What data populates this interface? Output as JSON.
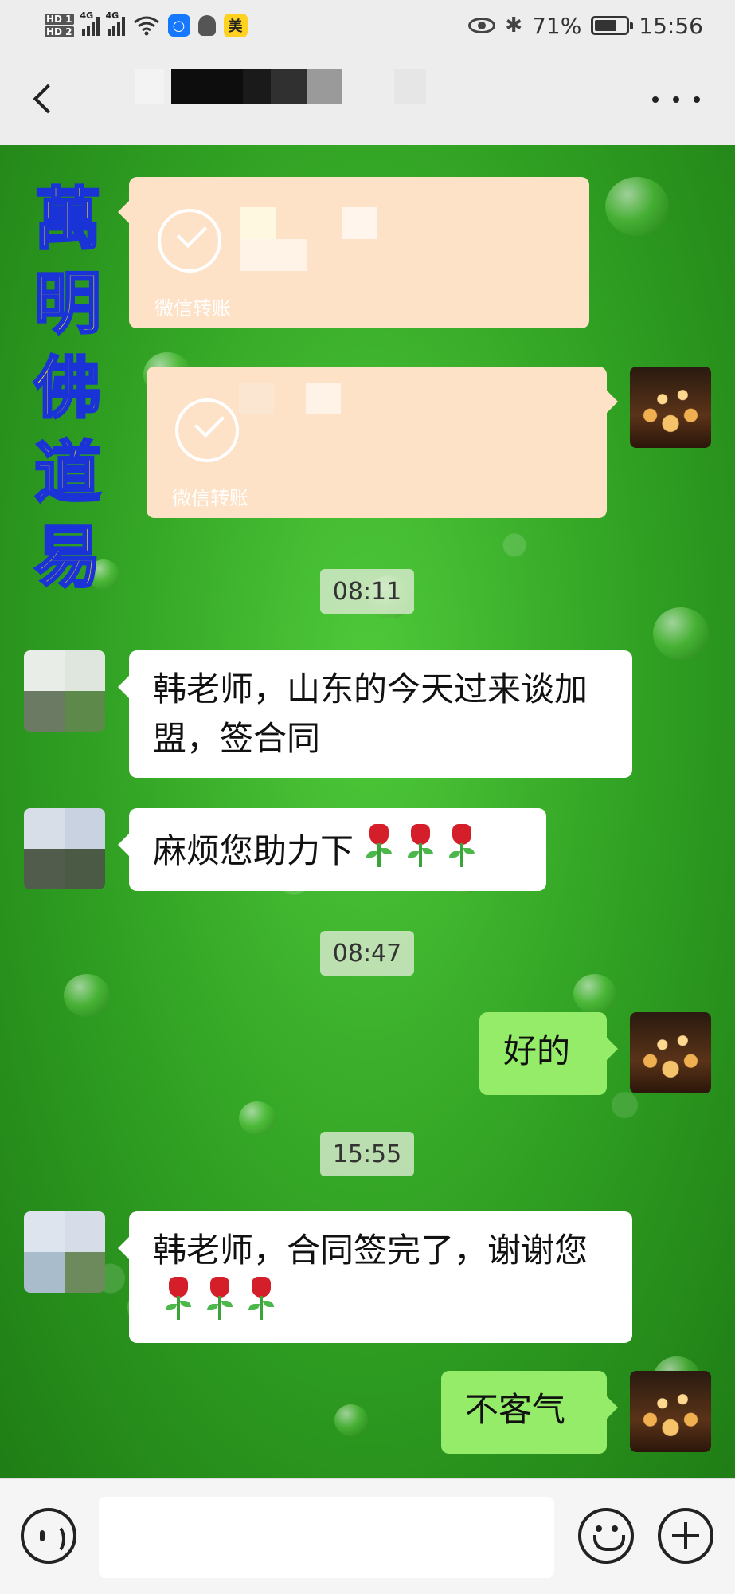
{
  "status_bar": {
    "network_1": "HD 1",
    "network_2": "HD 2",
    "signal_1": "4G",
    "signal_2": "4G",
    "app_badge": "美",
    "battery_percent": "71%",
    "time": "15:56"
  },
  "calligraphy": [
    "萬",
    "明",
    "佛",
    "道",
    "易"
  ],
  "messages": {
    "transfer_1_label": "微信转账",
    "transfer_2_label": "微信转账",
    "time_1": "08:11",
    "msg_1": "韩老师，山东的今天过来谈加盟，签合同",
    "msg_2": "麻烦您助力下",
    "time_2": "08:47",
    "reply_1": "好的",
    "time_3": "15:55",
    "msg_3": "韩老师，合同签完了，谢谢您",
    "reply_2": "不客气"
  },
  "colors": {
    "chat_background": "#2f9f22",
    "received_bubble": "#ffffff",
    "sent_bubble": "#95ec69",
    "transfer_card": "#fde2c8",
    "calligraphy_fill": "#ffe21a",
    "calligraphy_stroke": "#1a33d6"
  },
  "icons": [
    "back-icon",
    "more-icon",
    "voice-icon",
    "emoji-icon",
    "plus-icon",
    "check-icon",
    "rose-icon",
    "wifi-icon",
    "bluetooth-icon",
    "battery-icon",
    "eye-icon"
  ]
}
